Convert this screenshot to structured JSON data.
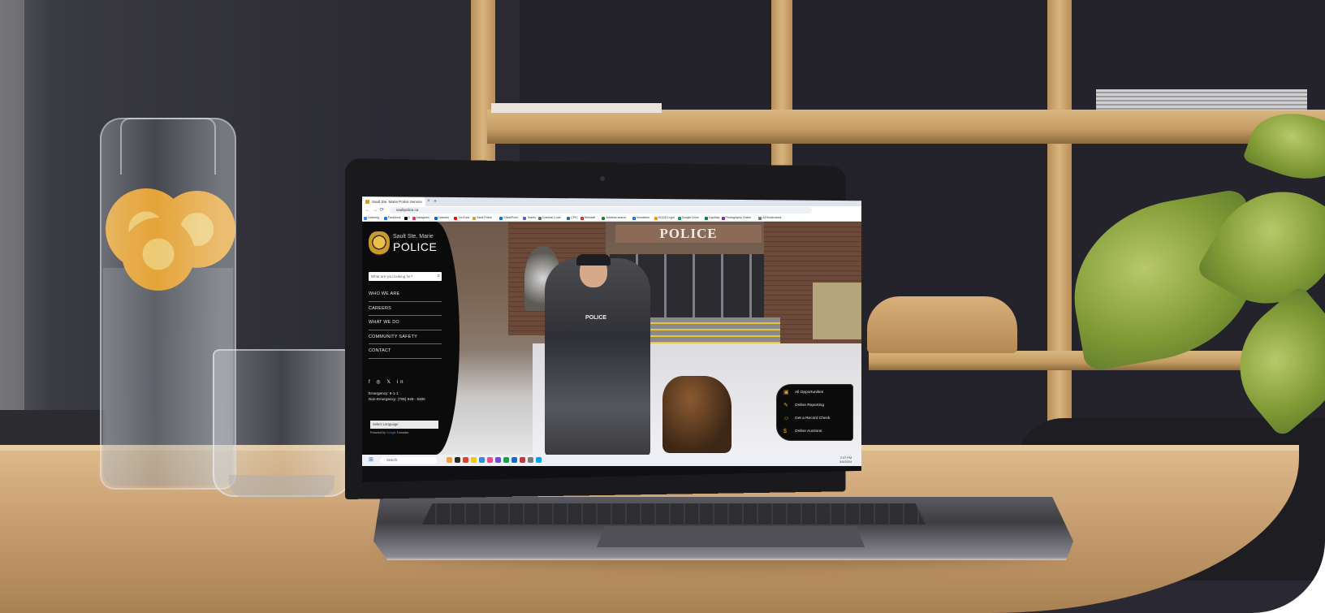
{
  "browser": {
    "tab_title": "Sault Ste. Marie Police Service",
    "tab_close": "×",
    "new_tab": "+",
    "back": "←",
    "forward": "→",
    "reload": "⟳",
    "url": "saultpolice.ca",
    "bookmarks": [
      "Learning",
      "Facebook",
      "X",
      "Instagram",
      "LinkedIn",
      "YouTube",
      "Sault Police",
      "SharePoint",
      "Teams",
      "Criminal Code",
      "CPIC",
      "Telestaff",
      "Address search",
      "Versaterm",
      "SOQS Login",
      "Google Drive",
      "CapMap",
      "Photography Online",
      "All Bookmarks"
    ]
  },
  "site": {
    "brand_small": "Sault Ste. Marie",
    "brand_big": "POLICE",
    "search_placeholder": "What are you looking for?",
    "menu": [
      "WHO WE ARE",
      "CAREERS",
      "WHAT WE DO",
      "COMMUNITY SAFETY",
      "CONTACT"
    ],
    "social_icons": [
      "facebook-icon",
      "instagram-icon",
      "twitter-icon",
      "linkedin-icon"
    ],
    "social_glyphs": "f ◎ 𝕏 in",
    "emergency": "Emergency: 9-1-1",
    "non_emergency": "Non-Emergency: (705) 949 - 6300",
    "translate_label": "Select Language",
    "powered_prefix": "Powered by",
    "powered_google": "Google",
    "powered_suffix": "Translate",
    "hero_sign": "POLICE",
    "vest_label": "POLICE",
    "quick_links": [
      {
        "label": "All Opportunities",
        "icon": "briefcase-icon",
        "glyph": "▣"
      },
      {
        "label": "Online Reporting",
        "icon": "report-icon",
        "glyph": "✎"
      },
      {
        "label": "Get a Record Check",
        "icon": "person-check-icon",
        "glyph": "☺"
      },
      {
        "label": "Online Auctions",
        "icon": "dollar-icon",
        "glyph": "$"
      }
    ]
  },
  "taskbar": {
    "start_glyph": "⊞",
    "search_label": "Search",
    "time": "2:37 PM",
    "date": "5/4/2024"
  }
}
